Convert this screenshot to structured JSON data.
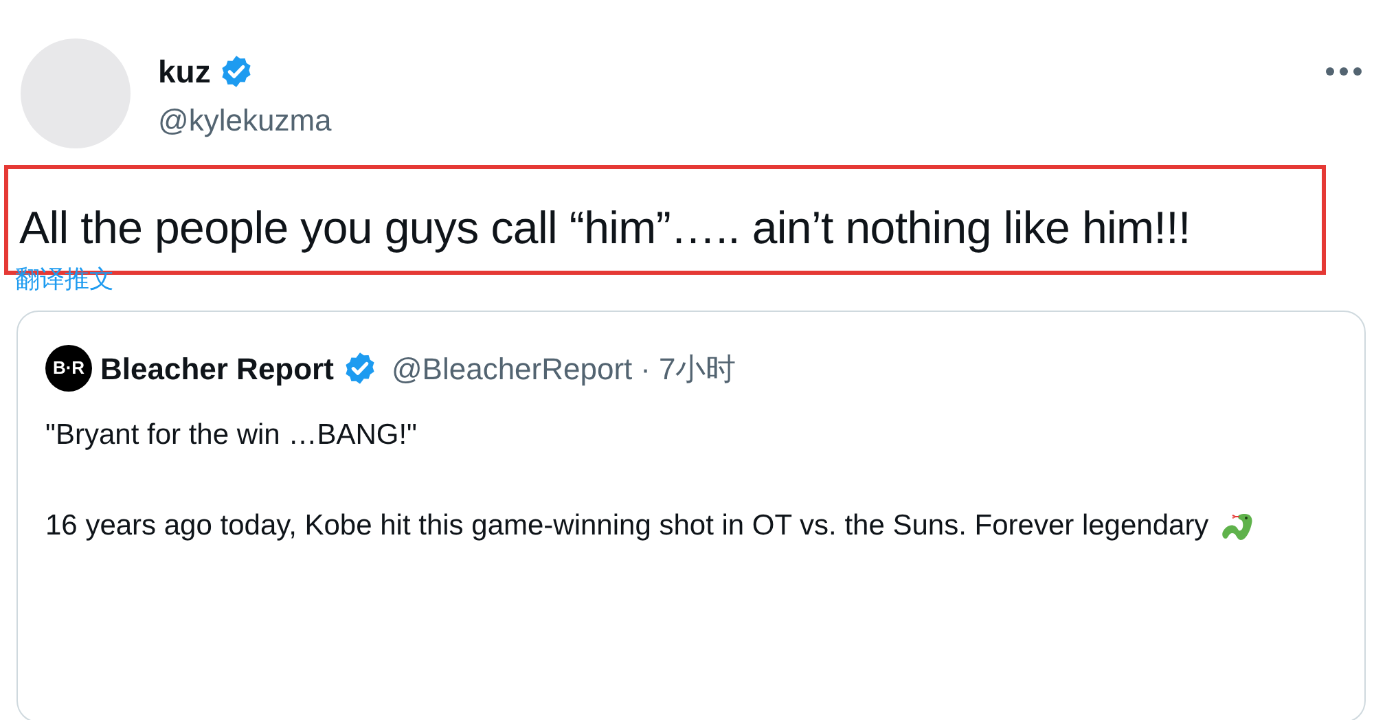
{
  "author": {
    "name": "kuz",
    "verified": true,
    "handle": "@kylekuzma"
  },
  "tweet_text": "All the people you guys call “him”….. ain’t nothing like him!!!",
  "highlighted": true,
  "translate_link": "翻译推文",
  "quoted_tweet": {
    "name": "Bleacher Report",
    "logo_text": "B·R",
    "verified": true,
    "handle": "@BleacherReport",
    "separator": "·",
    "time": "7小时",
    "paragraphs": [
      "\"Bryant for the win …BANG!\"",
      "16 years ago today, Kobe hit this game-winning shot in OT vs. the Suns. Forever legendary"
    ]
  }
}
